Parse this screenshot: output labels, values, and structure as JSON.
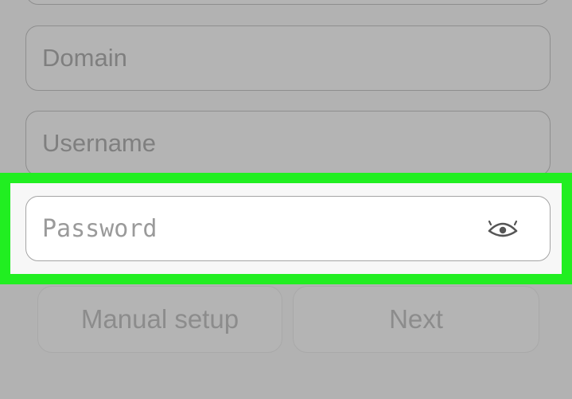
{
  "form": {
    "top_field": {
      "placeholder": ""
    },
    "domain": {
      "placeholder": "Domain"
    },
    "username": {
      "placeholder": "Username"
    },
    "password": {
      "placeholder": "Password",
      "toggle_icon": "eye-icon"
    }
  },
  "buttons": {
    "manual_setup_label": "Manual setup",
    "next_label": "Next"
  },
  "colors": {
    "highlight": "#21ee21",
    "overlay": "#b2b2b2",
    "field_background_active": "#ffffff"
  }
}
